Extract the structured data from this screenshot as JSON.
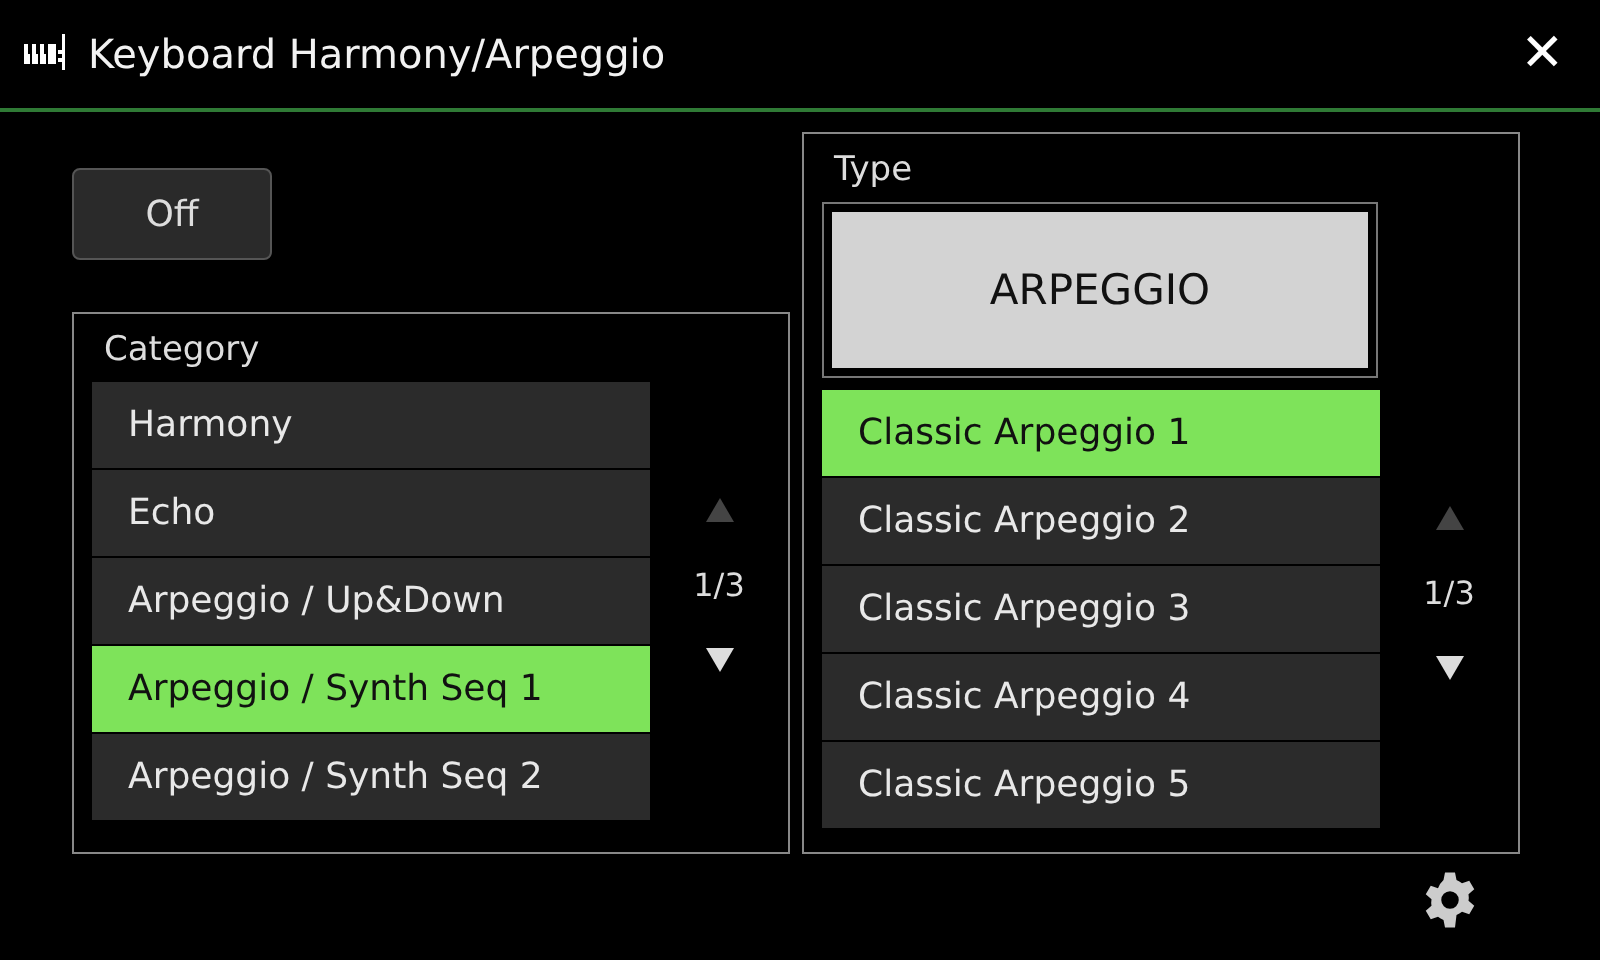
{
  "window": {
    "title": "Keyboard Harmony/Arpeggio",
    "close": "✕"
  },
  "off_button": {
    "label": "Off"
  },
  "category": {
    "title": "Category",
    "page": "1/3",
    "scroll_up": {
      "disabled": true
    },
    "scroll_down": {
      "disabled": false
    },
    "items": [
      {
        "label": "Harmony",
        "selected": false
      },
      {
        "label": "Echo",
        "selected": false
      },
      {
        "label": "Arpeggio / Up&Down",
        "selected": false
      },
      {
        "label": "Arpeggio / Synth Seq 1",
        "selected": true
      },
      {
        "label": "Arpeggio / Synth Seq 2",
        "selected": false
      }
    ]
  },
  "type": {
    "title": "Type",
    "button": "ARPEGGIO",
    "page": "1/3",
    "scroll_up": {
      "disabled": true
    },
    "scroll_down": {
      "disabled": false
    },
    "items": [
      {
        "label": "Classic Arpeggio 1",
        "selected": true
      },
      {
        "label": "Classic Arpeggio 2",
        "selected": false
      },
      {
        "label": "Classic Arpeggio 3",
        "selected": false
      },
      {
        "label": "Classic Arpeggio 4",
        "selected": false
      },
      {
        "label": "Classic Arpeggio 5",
        "selected": false
      }
    ]
  }
}
